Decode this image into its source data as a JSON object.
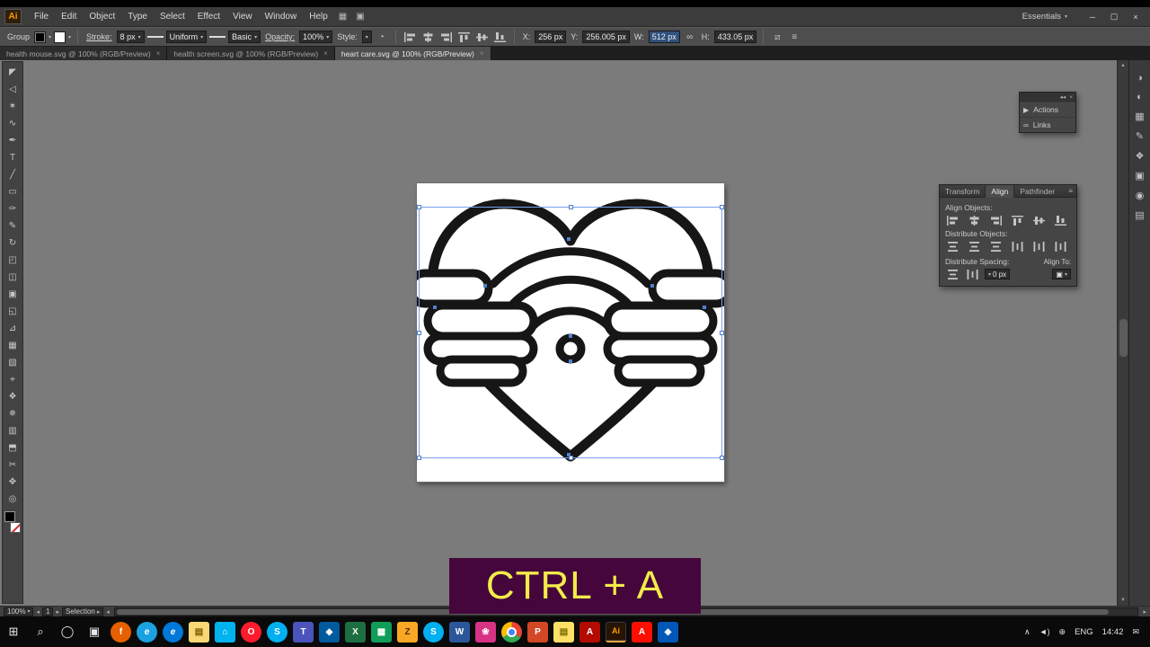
{
  "ui": {
    "caret_down": "▾",
    "caret_up": "▴",
    "left_arrow": "◂",
    "right_arrow": "▸",
    "scroll_up": "▲",
    "scroll_down": "▼",
    "panel_menu": "≡",
    "collapse": "◂◂",
    "close": "×"
  },
  "menu": {
    "logo": "Ai",
    "items": [
      "File",
      "Edit",
      "Object",
      "Type",
      "Select",
      "Effect",
      "View",
      "Window",
      "Help"
    ],
    "icons": [
      {
        "name": "arrange-documents",
        "glyph": "▦"
      },
      {
        "name": "switch-workspace",
        "glyph": "▣"
      }
    ],
    "workspace": "Essentials",
    "win_min": "─",
    "win_restore": "▢",
    "win_close": "×"
  },
  "control_bar": {
    "selection_label": "Group",
    "stroke_label": "Stroke:",
    "stroke_value": "8 px",
    "width_profile": "Uniform",
    "brush_definition": "Basic",
    "opacity_label": "Opacity:",
    "opacity_value": "100%",
    "style_label": "Style:",
    "icons": {
      "recolor": "◔",
      "constrain": "∞",
      "shear": "⧄",
      "panel_menu": "≡"
    },
    "x_label": "X:",
    "x_value": "256 px",
    "y_label": "Y:",
    "y_value": "256.005 px",
    "w_label": "W:",
    "w_value": "512 px",
    "h_label": "H:",
    "h_value": "433.05 px"
  },
  "tabs": [
    {
      "label": "health mouse.svg @ 100% (RGB/Preview)"
    },
    {
      "label": "health screen.svg @ 100% (RGB/Preview)"
    },
    {
      "label": "heart care.svg @ 100% (RGB/Preview)"
    }
  ],
  "toolbar": {
    "tools": [
      {
        "name": "selection",
        "glyph": "◤"
      },
      {
        "name": "direct-selection",
        "glyph": "◁"
      },
      {
        "name": "magic-wand",
        "glyph": "✶"
      },
      {
        "name": "lasso",
        "glyph": "∿"
      },
      {
        "name": "pen",
        "glyph": "✒"
      },
      {
        "name": "type",
        "glyph": "T"
      },
      {
        "name": "line-segment",
        "glyph": "╱"
      },
      {
        "name": "rectangle",
        "glyph": "▭"
      },
      {
        "name": "paintbrush",
        "glyph": "✑"
      },
      {
        "name": "pencil",
        "glyph": "✎"
      },
      {
        "name": "rotate",
        "glyph": "↻"
      },
      {
        "name": "scale",
        "glyph": "◰"
      },
      {
        "name": "width-tool",
        "glyph": "◫"
      },
      {
        "name": "free-transform",
        "glyph": "▣"
      },
      {
        "name": "shape-builder",
        "glyph": "◱"
      },
      {
        "name": "perspective-grid",
        "glyph": "⊿"
      },
      {
        "name": "mesh",
        "glyph": "▦"
      },
      {
        "name": "gradient",
        "glyph": "▧"
      },
      {
        "name": "eyedropper",
        "glyph": "⌖"
      },
      {
        "name": "blend",
        "glyph": "❖"
      },
      {
        "name": "symbol-sprayer",
        "glyph": "✵"
      },
      {
        "name": "column-graph",
        "glyph": "▥"
      },
      {
        "name": "artboard",
        "glyph": "⬒"
      },
      {
        "name": "slice",
        "glyph": "✂"
      },
      {
        "name": "hand",
        "glyph": "✥"
      },
      {
        "name": "zoom",
        "glyph": "◎"
      }
    ]
  },
  "panels": {
    "actions_links": {
      "items": [
        {
          "icon": "▶",
          "label": "Actions"
        },
        {
          "icon": "∞",
          "label": "Links"
        }
      ]
    },
    "align": {
      "tabs": [
        {
          "label": "Transform"
        },
        {
          "label": "Align"
        },
        {
          "label": "Pathfinder"
        }
      ],
      "align_objects_label": "Align Objects:",
      "distribute_objects_label": "Distribute Objects:",
      "distribute_spacing_label": "Distribute Spacing:",
      "align_to_label": "Align To:",
      "align_to_glyph": "▣",
      "spacing_value": "0 px"
    }
  },
  "status_bar": {
    "zoom": "100%",
    "artboard_value": "1",
    "tool": "Selection"
  },
  "overlay": {
    "text": "CTRL + A",
    "bg": "#45063c",
    "fg": "#f2ec4a"
  },
  "taskbar": {
    "start_glyph": "⊞",
    "icons": [
      {
        "name": "search",
        "glyph": "⌕"
      },
      {
        "name": "cortana",
        "glyph": "◯"
      },
      {
        "name": "task-view",
        "glyph": "▣"
      },
      {
        "name": "firefox",
        "glyph": "f"
      },
      {
        "name": "internet-explorer",
        "glyph": "e"
      },
      {
        "name": "edge",
        "glyph": "e"
      },
      {
        "name": "file-explorer",
        "glyph": "▤"
      },
      {
        "name": "store",
        "glyph": "⌂"
      },
      {
        "name": "opera",
        "glyph": "O"
      },
      {
        "name": "skype",
        "glyph": "S"
      },
      {
        "name": "teams",
        "glyph": "T"
      },
      {
        "name": "defender",
        "glyph": "◆"
      },
      {
        "name": "excel",
        "glyph": "X"
      },
      {
        "name": "sheets",
        "glyph": "▦"
      },
      {
        "name": "zoom-app",
        "glyph": "Z"
      },
      {
        "name": "skype-2",
        "glyph": "S"
      },
      {
        "name": "word",
        "glyph": "W"
      },
      {
        "name": "photos",
        "glyph": "❀"
      },
      {
        "name": "chrome",
        "glyph": ""
      },
      {
        "name": "powerpoint",
        "glyph": "P"
      },
      {
        "name": "sticky-notes",
        "glyph": "▤"
      },
      {
        "name": "acrobat",
        "glyph": "A"
      },
      {
        "name": "illustrator",
        "glyph": "Ai"
      },
      {
        "name": "reader",
        "glyph": "A"
      },
      {
        "name": "paint",
        "glyph": "◈"
      }
    ],
    "tray_icons": [
      {
        "name": "hidden-icons",
        "glyph": "∧"
      },
      {
        "name": "volume",
        "glyph": "◄)"
      },
      {
        "name": "network",
        "glyph": "⊕"
      }
    ],
    "lang": "ENG",
    "time": "14:42",
    "action_center_glyph": "✉"
  },
  "dock": {
    "icons": [
      {
        "name": "color",
        "glyph": "◑"
      },
      {
        "name": "color-guide",
        "glyph": "◐"
      },
      {
        "name": "swatches",
        "glyph": "▦"
      },
      {
        "name": "brushes",
        "glyph": "✎"
      },
      {
        "name": "symbols",
        "glyph": "❖"
      },
      {
        "name": "graphic-styles",
        "glyph": "▣"
      },
      {
        "name": "appearance",
        "glyph": "◉"
      },
      {
        "name": "layers",
        "glyph": "▤"
      }
    ]
  }
}
